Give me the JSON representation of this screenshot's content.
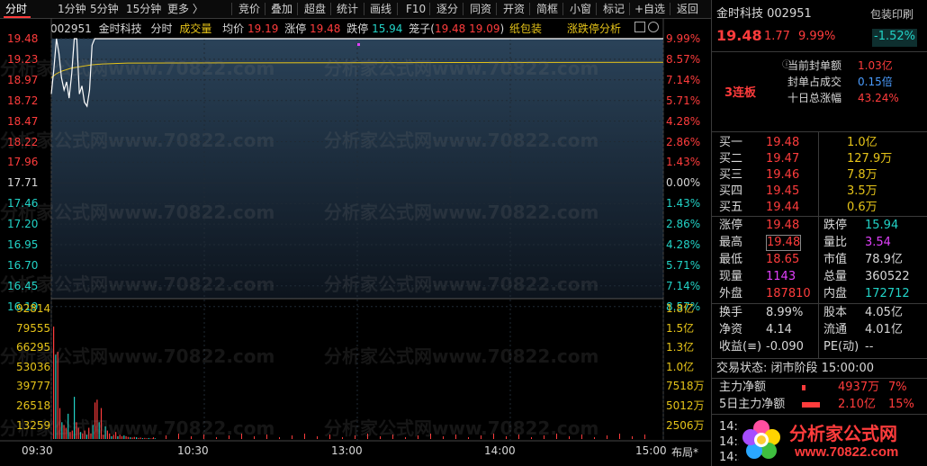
{
  "toolbar": {
    "tabs": [
      "分时",
      "1分钟",
      "5分钟",
      "15分钟",
      "更多 〉"
    ],
    "buttons": [
      "竞价",
      "叠加",
      "超盘",
      "统计",
      "画线",
      "F10",
      "逐分",
      "同资",
      "开资",
      "简框",
      "小窗",
      "标记",
      "+自选",
      "返回"
    ]
  },
  "chart_info": {
    "code": "002951",
    "name": "金时科技",
    "mode": "分时",
    "vol_label": "成交量",
    "avg_label": "均价",
    "avg": "19.19",
    "up_label": "涨停",
    "up": "19.48",
    "down_label": "跌停",
    "down": "15.94",
    "cage": "笼子(",
    "cage_lo": "19.48",
    "cage_hi": "19.09",
    "cage_close": ")",
    "concept": "纸包装",
    "limit_analysis": "涨跌停分析"
  },
  "price_axis": [
    "19.48",
    "19.23",
    "18.97",
    "18.72",
    "18.47",
    "18.22",
    "17.96",
    "17.71",
    "17.46",
    "17.20",
    "16.95",
    "16.70",
    "16.45",
    "16.19"
  ],
  "pct_axis": [
    "9.99%",
    "8.57%",
    "7.14%",
    "5.71%",
    "4.28%",
    "2.86%",
    "1.43%",
    "0.00%",
    "1.43%",
    "2.86%",
    "4.28%",
    "5.71%",
    "7.14%",
    "8.57%"
  ],
  "vol_axis": [
    "92814",
    "79555",
    "66295",
    "53036",
    "39777",
    "26518",
    "13259"
  ],
  "amount_axis": [
    "1.8亿",
    "1.5亿",
    "1.3亿",
    "1.0亿",
    "7518万",
    "5012万",
    "2506万"
  ],
  "time_axis": [
    "09:30",
    "10:30",
    "13:00",
    "14:00",
    "15:00"
  ],
  "layout_btn": "布局*",
  "watermark": "分析家公式网www.70822.com",
  "colors": {
    "up": "#ff3c3c",
    "down": "#22d3c7",
    "avg": "#e6c419",
    "price": "#ffffff"
  },
  "chart_data": {
    "type": "line",
    "price_ylim": [
      16.19,
      19.48
    ],
    "prev_close": 17.71,
    "price_series_x": [
      "09:30",
      "09:31",
      "09:32",
      "09:33",
      "09:34",
      "09:35",
      "09:36",
      "09:37",
      "09:38",
      "09:39",
      "09:40",
      "09:41",
      "09:42",
      "09:43",
      "09:44",
      "09:45",
      "09:46",
      "09:47",
      "09:48",
      "09:49",
      "09:50",
      "10:00",
      "11:30",
      "13:00",
      "14:00",
      "15:00"
    ],
    "price_series": [
      18.8,
      19.1,
      19.48,
      19.3,
      19.0,
      18.85,
      18.95,
      18.75,
      19.05,
      19.48,
      19.48,
      18.8,
      18.9,
      18.7,
      18.65,
      18.85,
      19.4,
      19.48,
      19.48,
      19.48,
      19.48,
      19.48,
      19.48,
      19.48,
      19.48,
      19.48
    ],
    "avg_series": [
      19.0,
      19.05,
      19.08,
      19.1,
      19.12,
      19.13,
      19.14,
      19.15,
      19.16,
      19.17,
      19.18,
      19.19
    ],
    "volume_ylim": [
      0,
      92814
    ],
    "volume_series": [
      80000,
      60000,
      62000,
      22000,
      12000,
      10000,
      8000,
      18000,
      5000,
      6000,
      30000,
      12000,
      8000,
      5000,
      4000,
      6000,
      3000,
      8000,
      4000,
      10000,
      26000,
      28000,
      12000,
      22000,
      3000,
      9000,
      6000,
      4000,
      2000,
      3000,
      5000,
      2000,
      3000,
      2000,
      2500,
      2000,
      1500,
      1200,
      1000,
      1500,
      1200,
      800,
      1000,
      600,
      800,
      500,
      700,
      400,
      600,
      500
    ]
  },
  "panel": {
    "title": "金时科技 002951",
    "tag": "包装印刷",
    "price": "19.48",
    "change": "1.77",
    "pct": "9.99%",
    "sector_pct": "-1.52%",
    "limit_streak": "3连板",
    "stats": [
      {
        "label": "当前封单额",
        "value": "1.03亿"
      },
      {
        "label": "封单占成交",
        "value": "0.15倍"
      },
      {
        "label": "十日总涨幅",
        "value": "43.24%"
      }
    ],
    "bids": [
      {
        "label": "买一",
        "price": "19.48",
        "vol": "1.0亿"
      },
      {
        "label": "买二",
        "price": "19.47",
        "vol": "127.9万"
      },
      {
        "label": "买三",
        "price": "19.46",
        "vol": "7.8万"
      },
      {
        "label": "买四",
        "price": "19.45",
        "vol": "3.5万"
      },
      {
        "label": "买五",
        "price": "19.44",
        "vol": "0.6万"
      }
    ],
    "quote": [
      {
        "l1": "涨停",
        "v1": "19.48",
        "l2": "跌停",
        "v2": "15.94"
      },
      {
        "l1": "最高",
        "v1": "19.48",
        "l2": "量比",
        "v2": "3.54"
      },
      {
        "l1": "最低",
        "v1": "18.65",
        "l2": "市值",
        "v2": "78.9亿"
      },
      {
        "l1": "现量",
        "v1": "1143",
        "l2": "总量",
        "v2": "360522"
      },
      {
        "l1": "外盘",
        "v1": "187810",
        "l2": "内盘",
        "v2": "172712"
      }
    ],
    "fund": [
      {
        "l1": "换手",
        "v1": "8.99%",
        "l2": "股本",
        "v2": "4.05亿"
      },
      {
        "l1": "净资",
        "v1": "4.14",
        "l2": "流通",
        "v2": "4.01亿"
      },
      {
        "l1": "收益(≡)",
        "v1": "-0.090",
        "l2": "PE(动)",
        "v2": "--"
      }
    ],
    "status": "交易状态: 闭市阶段 15:00:00",
    "flow": [
      {
        "label": "主力净额",
        "amount": "4937万",
        "pct": "7%"
      },
      {
        "label": "5日主力净额",
        "amount": "2.10亿",
        "pct": "15%"
      }
    ],
    "logo_text": "分析家公式网",
    "logo_url": "www.70822.com",
    "tick_times": [
      "14:5",
      "14:5",
      "14:5"
    ]
  }
}
